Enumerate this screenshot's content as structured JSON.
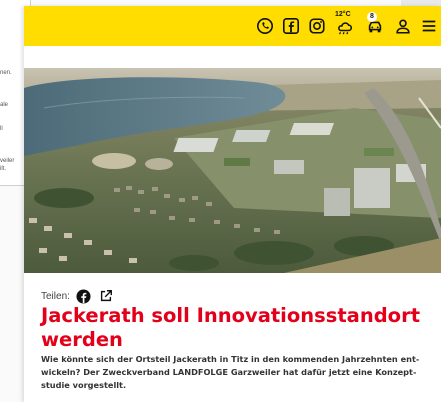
{
  "background": {
    "snippets": [
      "nen.",
      "ale",
      "ll",
      "veiler",
      "ilt."
    ]
  },
  "header": {
    "bar_color": "#ffdd00",
    "icons": [
      "whatsapp-icon",
      "facebook-icon",
      "instagram-icon",
      "weather-icon",
      "car-icon",
      "user-icon",
      "menu-icon"
    ],
    "weather_temp": "12°C",
    "traffic_count": "8"
  },
  "article": {
    "share_label": "Teilen:",
    "title": "Jackerath soll Innovationsstandort werden",
    "lead": "Wie könnte sich der Ortsteil Jackerath in Titz in den kommenden Jahrzehnten ent-wickeln? Der Zweckverband LANDFOLGE Garzweiler hat dafür jetzt eine Konzept-studie vorgestellt.",
    "title_color": "#e2001a"
  }
}
